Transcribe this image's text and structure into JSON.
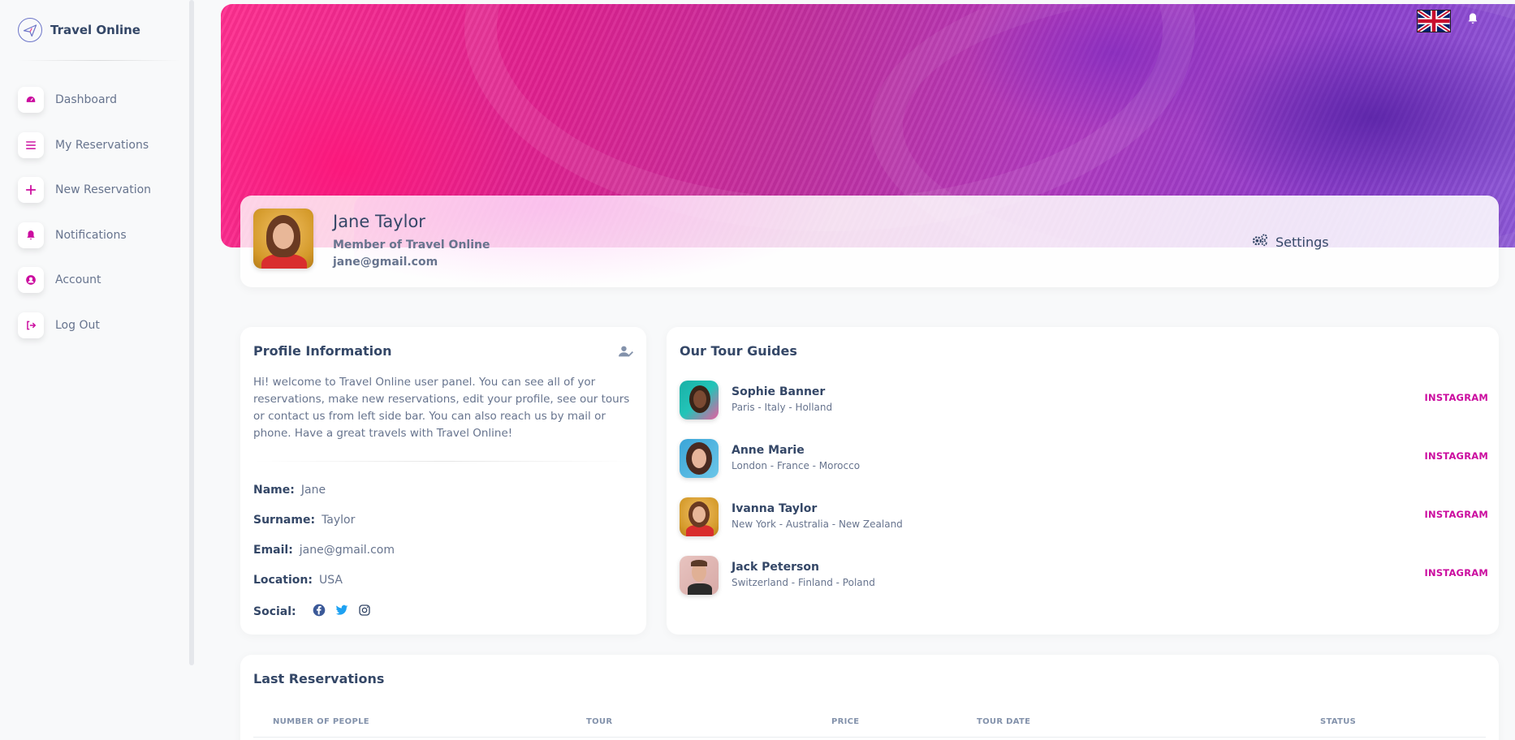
{
  "brand": {
    "name": "Travel Online"
  },
  "sidebar": {
    "items": [
      {
        "label": "Dashboard",
        "icon": "dashboard-icon"
      },
      {
        "label": "My Reservations",
        "icon": "list-icon"
      },
      {
        "label": "New Reservation",
        "icon": "plus-icon"
      },
      {
        "label": "Notifications",
        "icon": "bell-icon"
      },
      {
        "label": "Account",
        "icon": "user-circle-icon"
      },
      {
        "label": "Log Out",
        "icon": "logout-icon"
      }
    ]
  },
  "header": {
    "language_flag": "uk-flag-icon",
    "notifications_icon": "bell-icon"
  },
  "profile": {
    "name": "Jane Taylor",
    "subtitle": "Member of Travel Online",
    "email": "jane@gmail.com",
    "settings_label": "Settings"
  },
  "profile_info": {
    "title": "Profile Information",
    "description": "Hi! welcome to Travel Online user panel. You can see all of yor reservations, make new reservations, edit your profile, see our tours or contact us from left side bar. You can also reach us by mail or phone. Have a great travels with Travel Online!",
    "fields": [
      {
        "label": "Name:",
        "value": "Jane"
      },
      {
        "label": "Surname:",
        "value": "Taylor"
      },
      {
        "label": "Email:",
        "value": "jane@gmail.com"
      },
      {
        "label": "Location:",
        "value": "USA"
      }
    ],
    "social_label": "Social:"
  },
  "guides": {
    "title": "Our Tour Guides",
    "items": [
      {
        "name": "Sophie Banner",
        "locations": "Paris - Italy - Holland",
        "link": "INSTAGRAM"
      },
      {
        "name": "Anne Marie",
        "locations": "London - France - Morocco",
        "link": "INSTAGRAM"
      },
      {
        "name": "Ivanna Taylor",
        "locations": "New York - Australia - New Zealand",
        "link": "INSTAGRAM"
      },
      {
        "name": "Jack Peterson",
        "locations": "Switzerland - Finland - Poland",
        "link": "INSTAGRAM"
      }
    ]
  },
  "reservations": {
    "title": "Last Reservations",
    "columns": [
      "NUMBER OF PEOPLE",
      "TOUR",
      "PRICE",
      "TOUR DATE",
      "STATUS"
    ]
  },
  "colors": {
    "accent": "#cb0c9f",
    "text": "#344767",
    "muted": "#67748e"
  }
}
